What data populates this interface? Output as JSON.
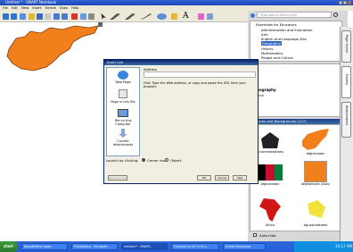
{
  "window": {
    "title": "Untitled * - SMART Notebook"
  },
  "menu": [
    "File",
    "Edit",
    "View",
    "Insert",
    "Format",
    "Draw",
    "Help"
  ],
  "toolbar_icons": [
    "back-icon",
    "forward-icon",
    "add-page-icon",
    "open-icon",
    "save-icon",
    "paste-icon",
    "undo-icon",
    "redo-icon",
    "delete-icon",
    "screen-shade-icon",
    "table-icon",
    "select-icon",
    "pen-icon",
    "creative-pen-icon",
    "line-icon",
    "shape-icon",
    "fill-icon",
    "text-icon",
    "magic-pen-icon",
    "properties-icon"
  ],
  "dialog": {
    "title": "Insert Link",
    "address_label": "Address",
    "address_value": "",
    "hint": "Hint: Type the Web address, or copy and paste the URL from your browser.",
    "options": [
      "Web Page",
      "Page in this File",
      "File on this Computer",
      "Current Attachments"
    ],
    "launch_label": "Launch by clicking:",
    "radio_corner": "Corner icon",
    "radio_object": "Object",
    "btn_remove": "Remove Link",
    "btn_ok": "OK",
    "btn_cancel": "Cancel",
    "btn_help": "Help"
  },
  "gallery": {
    "search_placeholder": "Type search terms here",
    "tree": [
      "Essentials for Educators",
      "Administration and Evaluation",
      "Arts",
      "English and Language Arts",
      "Geography",
      "History",
      "Mathematics",
      "People and Culture"
    ],
    "selected_tree_item": "Geography",
    "section_header": "Pictures and Backgrounds (127)",
    "folder_label": "Geography",
    "folder_sub": "Africa",
    "items": [
      "Accommodations",
      "Afghanistan",
      "Afghanistan",
      "Afghanistan (Asia)",
      "Africa",
      "Aguascalientes"
    ],
    "auto_hide": "Auto-hide"
  },
  "side_tabs": [
    "Page Sorter",
    "Gallery",
    "Attachments"
  ],
  "taskbar": {
    "start": "start",
    "tasks": [
      "Nova4Edition Appli...",
      "Publications - Microsoft...",
      "Untitled * - SMART...",
      "Common on Dr Fx (H:)...",
      "United Streaming"
    ],
    "clock": "10:17 AM"
  },
  "colors": {
    "shape_fill": "#f07f1c",
    "title_blue": "#245edb",
    "dialog_blue": "#0a246a"
  }
}
